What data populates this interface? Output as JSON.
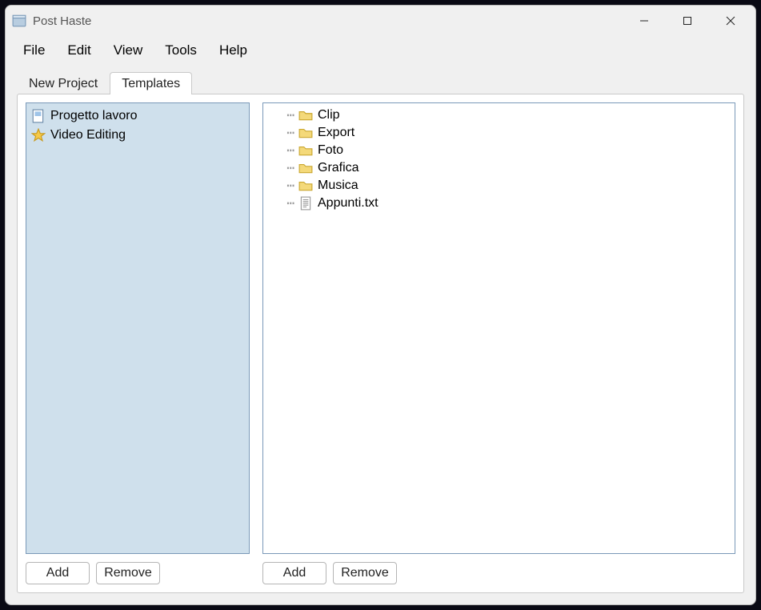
{
  "app": {
    "title": "Post Haste"
  },
  "menu": {
    "file": "File",
    "edit": "Edit",
    "view": "View",
    "tools": "Tools",
    "help": "Help"
  },
  "tabs": {
    "new_project": "New Project",
    "templates": "Templates",
    "active": "templates"
  },
  "templates": {
    "items": [
      {
        "label": "Progetto lavoro",
        "icon": "document"
      },
      {
        "label": "Video Editing",
        "icon": "star"
      }
    ]
  },
  "tree": {
    "items": [
      {
        "label": "Clip",
        "icon": "folder"
      },
      {
        "label": "Export",
        "icon": "folder"
      },
      {
        "label": "Foto",
        "icon": "folder"
      },
      {
        "label": "Grafica",
        "icon": "folder"
      },
      {
        "label": "Musica",
        "icon": "folder"
      },
      {
        "label": "Appunti.txt",
        "icon": "textfile"
      }
    ]
  },
  "buttons": {
    "add": "Add",
    "remove": "Remove"
  }
}
